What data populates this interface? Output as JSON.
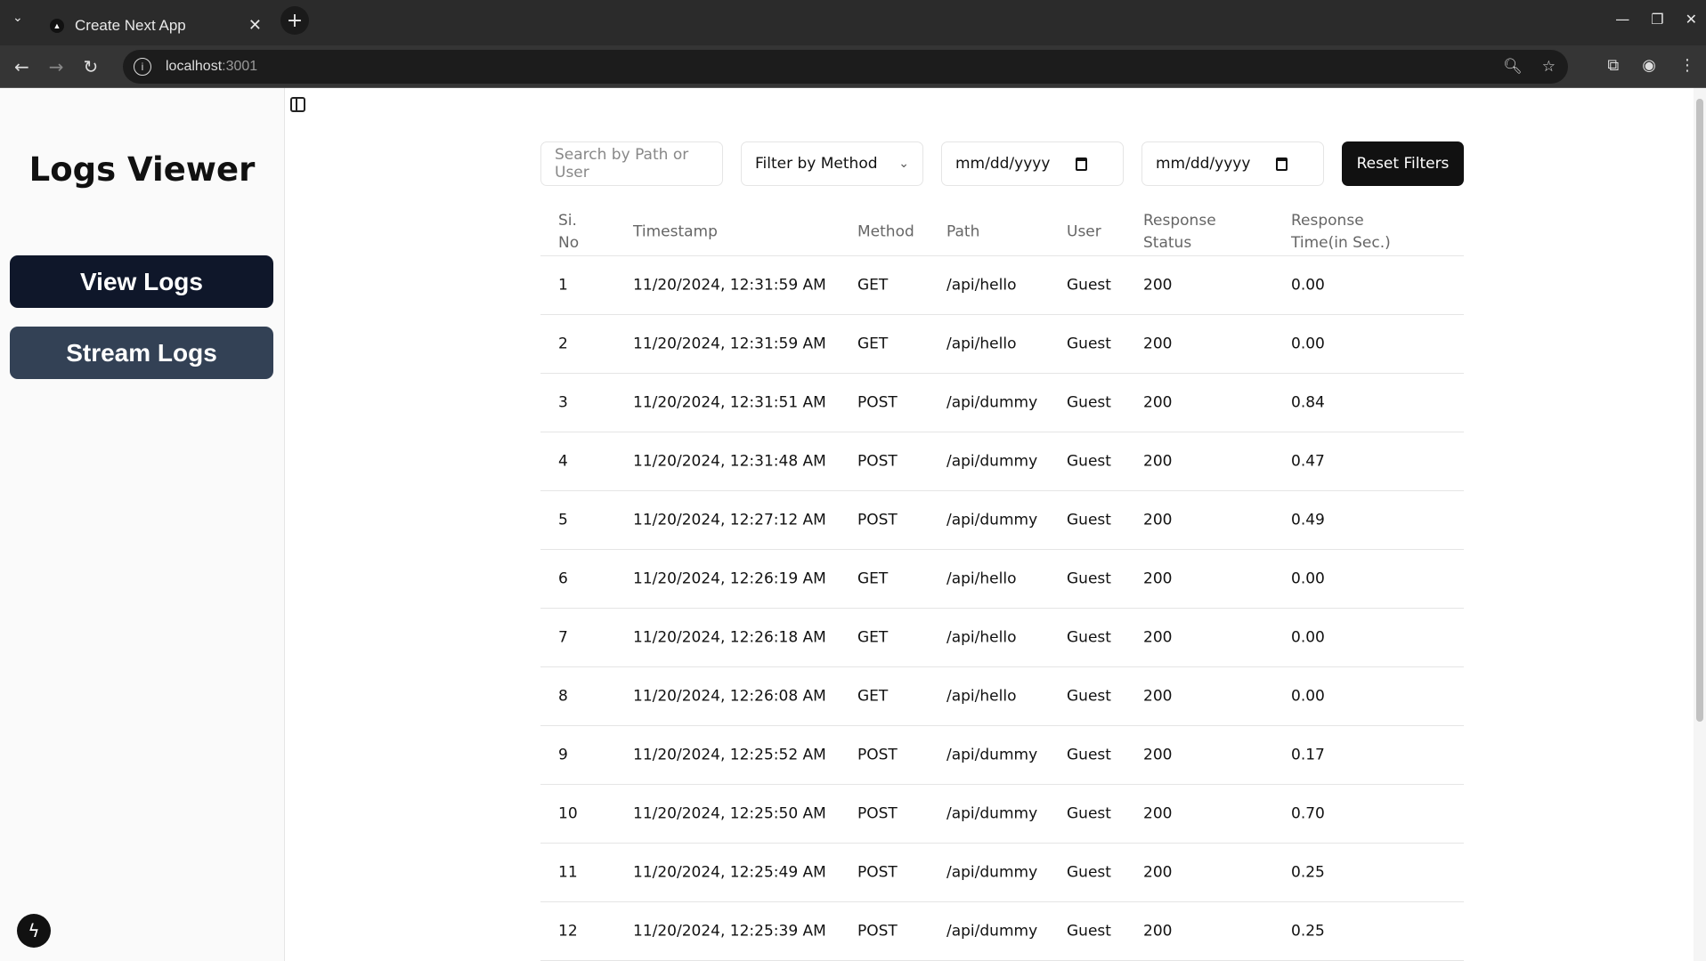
{
  "browser": {
    "tab_title": "Create Next App",
    "url_host": "localhost",
    "url_port": ":3001"
  },
  "sidebar": {
    "title": "Logs Viewer",
    "items": [
      {
        "label": "View Logs"
      },
      {
        "label": "Stream Logs"
      }
    ]
  },
  "filters": {
    "search_placeholder": "Search by Path or User",
    "method_label": "Filter by Method",
    "date_start": "mm/dd/yyyy",
    "date_end": "mm/dd/yyyy",
    "reset_label": "Reset Filters"
  },
  "table": {
    "headers": [
      "Si. No",
      "Timestamp",
      "Method",
      "Path",
      "User",
      "Response Status",
      "Response Time(in Sec.)"
    ],
    "rows": [
      [
        "1",
        "11/20/2024, 12:31:59 AM",
        "GET",
        "/api/hello",
        "Guest",
        "200",
        "0.00"
      ],
      [
        "2",
        "11/20/2024, 12:31:59 AM",
        "GET",
        "/api/hello",
        "Guest",
        "200",
        "0.00"
      ],
      [
        "3",
        "11/20/2024, 12:31:51 AM",
        "POST",
        "/api/dummy",
        "Guest",
        "200",
        "0.84"
      ],
      [
        "4",
        "11/20/2024, 12:31:48 AM",
        "POST",
        "/api/dummy",
        "Guest",
        "200",
        "0.47"
      ],
      [
        "5",
        "11/20/2024, 12:27:12 AM",
        "POST",
        "/api/dummy",
        "Guest",
        "200",
        "0.49"
      ],
      [
        "6",
        "11/20/2024, 12:26:19 AM",
        "GET",
        "/api/hello",
        "Guest",
        "200",
        "0.00"
      ],
      [
        "7",
        "11/20/2024, 12:26:18 AM",
        "GET",
        "/api/hello",
        "Guest",
        "200",
        "0.00"
      ],
      [
        "8",
        "11/20/2024, 12:26:08 AM",
        "GET",
        "/api/hello",
        "Guest",
        "200",
        "0.00"
      ],
      [
        "9",
        "11/20/2024, 12:25:52 AM",
        "POST",
        "/api/dummy",
        "Guest",
        "200",
        "0.17"
      ],
      [
        "10",
        "11/20/2024, 12:25:50 AM",
        "POST",
        "/api/dummy",
        "Guest",
        "200",
        "0.70"
      ],
      [
        "11",
        "11/20/2024, 12:25:49 AM",
        "POST",
        "/api/dummy",
        "Guest",
        "200",
        "0.25"
      ],
      [
        "12",
        "11/20/2024, 12:25:39 AM",
        "POST",
        "/api/dummy",
        "Guest",
        "200",
        "0.25"
      ]
    ]
  }
}
